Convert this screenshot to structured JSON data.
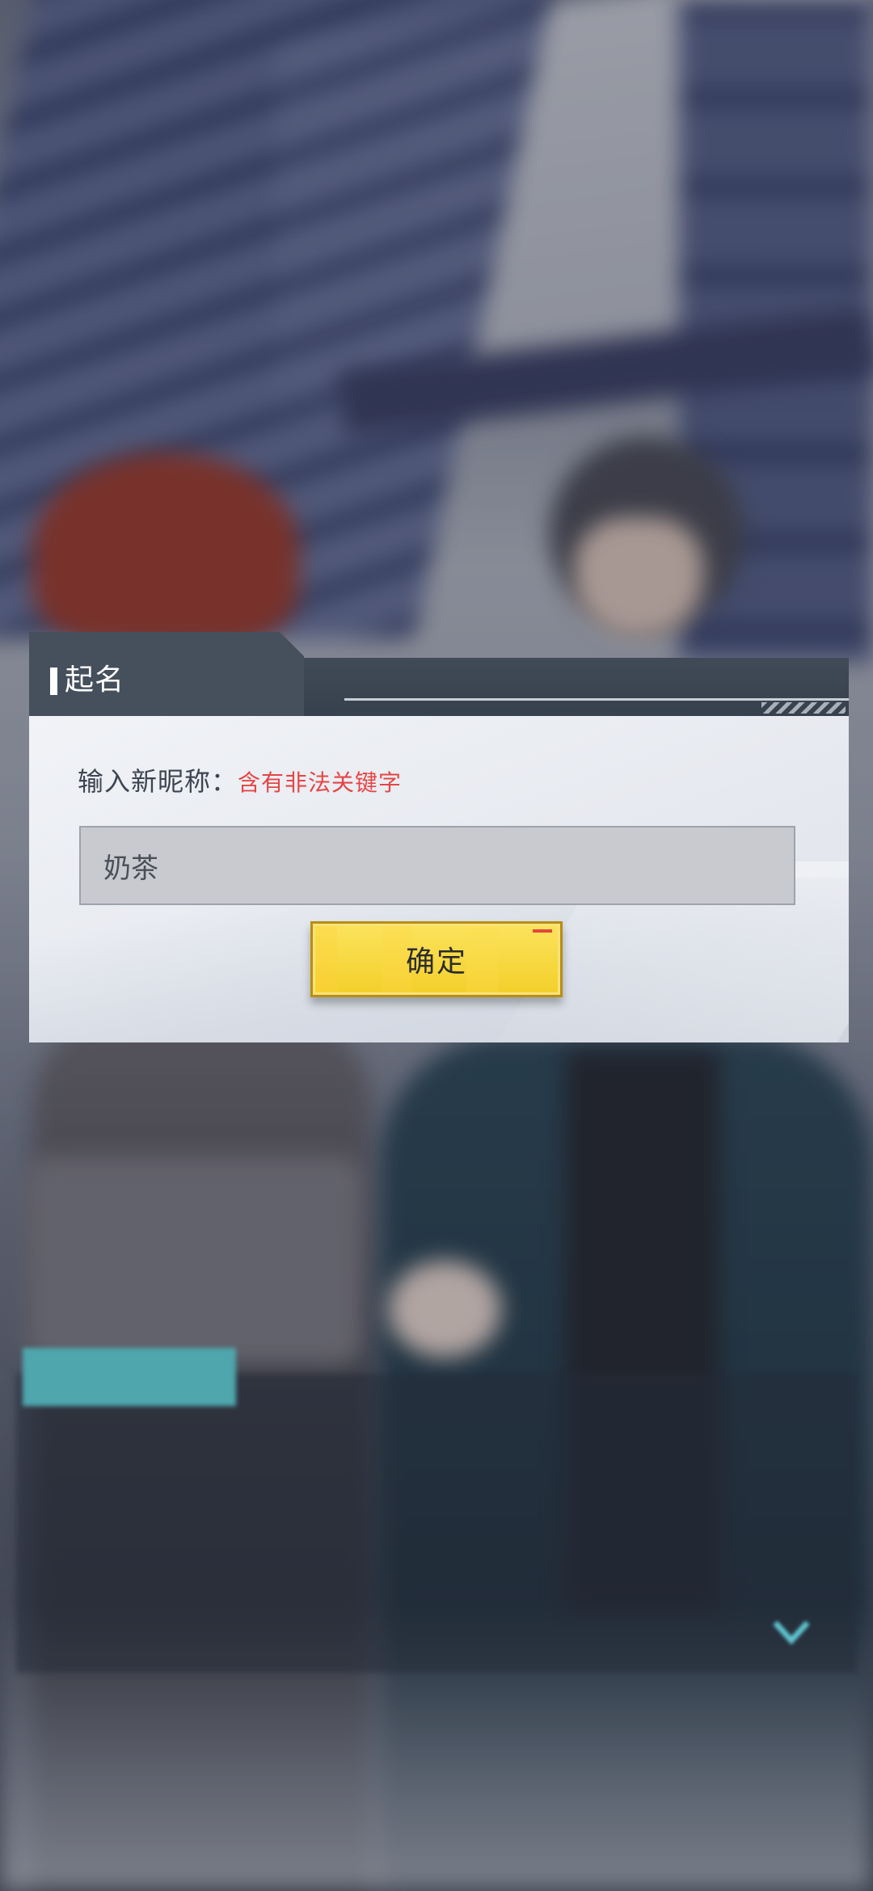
{
  "modal": {
    "title": "起名",
    "prompt_label": "输入新昵称：",
    "error_text": "含有非法关键字",
    "input_value": "奶茶",
    "confirm_label": "确定"
  },
  "colors": {
    "header_bg": "#414b57",
    "body_bg": "#e9ecf1",
    "error_text": "#e44646",
    "button_bg": "#f5d232",
    "button_border": "#b88f12"
  },
  "icons": [
    "advance-chevron-icon"
  ]
}
